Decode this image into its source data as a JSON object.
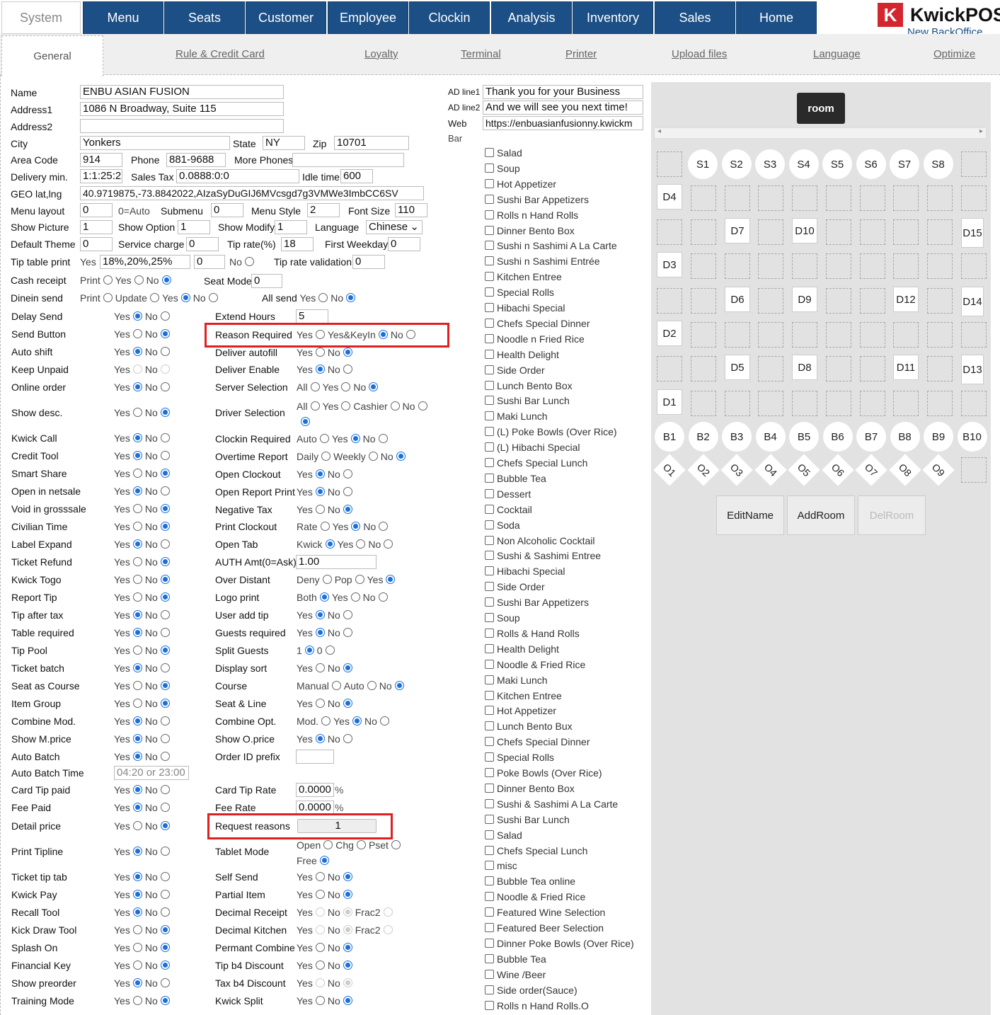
{
  "nav": {
    "system": "System",
    "items": [
      "Menu",
      "Seats",
      "Customer",
      "Employee",
      "Clockin",
      "Analysis",
      "Inventory",
      "Sales",
      "Home"
    ]
  },
  "logo": {
    "mark": "K",
    "name": "KwickPOS",
    "sub": "New BackOffice"
  },
  "tabs": {
    "general": "General",
    "links": [
      "Rule & Credit Card",
      "Loyalty",
      "Terminal",
      "Printer",
      "Upload files",
      "Language",
      "Optimize"
    ]
  },
  "store": {
    "name_label": "Name",
    "name": "ENBU ASIAN FUSION",
    "addr1_label": "Address1",
    "addr1": "1086 N Broadway,  Suite 115",
    "addr2_label": "Address2",
    "addr2": "",
    "city_label": "City",
    "city": "Yonkers",
    "state_label": "State",
    "state": "NY",
    "zip_label": "Zip",
    "zip": "10701",
    "area_label": "Area Code",
    "area": "914",
    "phone_label": "Phone",
    "phone": "881-9688",
    "more_label": "More Phones",
    "more": "",
    "delivery_label": "Delivery min.",
    "delivery": "1:1:25:2",
    "tax_label": "Sales Tax",
    "tax": "0.0888:0:0",
    "idle_label": "Idle time",
    "idle": "600",
    "geo_label": "GEO lat,lng",
    "geo": "40.9719875,-73.8842022,AIzaSyDuGIJ6MVcsgd7g3VMWe3ImbCC6SV",
    "menulayout_label": "Menu layout",
    "menulayout": "0",
    "auto_label": "0=Auto",
    "submenu_label": "Submenu",
    "submenu": "0",
    "menustyle_label": "Menu Style",
    "menustyle": "2",
    "fontsize_label": "Font Size",
    "fontsize": "110",
    "showpic_label": "Show Picture",
    "showpic": "1",
    "showopt_label": "Show Option",
    "showopt": "1",
    "showmod_label": "Show Modify",
    "showmod": "1",
    "lang_label": "Language",
    "lang": "Chinese",
    "theme_label": "Default Theme",
    "theme": "0",
    "svc_label": "Service charge",
    "svc": "0",
    "tiprate_label": "Tip rate(%)",
    "tiprate": "18",
    "firstwk_label": "First Weekday",
    "firstwk": "0",
    "tiptable_label": "Tip table print",
    "tiptable_yes": "Yes",
    "tiptable": "18%,20%,25%",
    "tiptable2": "0",
    "no": "No",
    "tipval_label": "Tip rate validation",
    "tipval": "0",
    "cash_label": "Cash receipt",
    "print": "Print",
    "yes": "Yes",
    "seatmode_label": "Seat Mode",
    "seatmode": "0",
    "dinein_label": "Dinein send",
    "update": "Update",
    "allsend_label": "All send"
  },
  "left_rows": [
    {
      "label": "Delay Send",
      "a": "Yes",
      "b": "No",
      "sel": "a"
    },
    {
      "label": "Send Button",
      "a": "Yes",
      "b": "No",
      "sel": "b"
    },
    {
      "label": "Auto shift",
      "a": "Yes",
      "b": "No",
      "sel": "a"
    },
    {
      "label": "Keep Unpaid",
      "a": "Yes",
      "b": "No",
      "sel": "dis"
    },
    {
      "label": "Online order",
      "a": "Yes",
      "b": "No",
      "sel": "a"
    },
    {
      "label": "Show desc.",
      "a": "Yes",
      "b": "No",
      "sel": "b"
    },
    {
      "label": "Kwick Call",
      "a": "Yes",
      "b": "No",
      "sel": "a"
    },
    {
      "label": "Credit Tool",
      "a": "Yes",
      "b": "No",
      "sel": "a"
    },
    {
      "label": "Smart Share",
      "a": "Yes",
      "b": "No",
      "sel": "b"
    },
    {
      "label": "Open in netsale",
      "a": "Yes",
      "b": "No",
      "sel": "a"
    },
    {
      "label": "Void in grosssale",
      "a": "Yes",
      "b": "No",
      "sel": "b"
    },
    {
      "label": "Civilian Time",
      "a": "Yes",
      "b": "No",
      "sel": "b"
    },
    {
      "label": "Label Expand",
      "a": "Yes",
      "b": "No",
      "sel": "a"
    },
    {
      "label": "Ticket Refund",
      "a": "Yes",
      "b": "No",
      "sel": "b"
    },
    {
      "label": "Kwick Togo",
      "a": "Yes",
      "b": "No",
      "sel": "b"
    },
    {
      "label": "Report Tip",
      "a": "Yes",
      "b": "No",
      "sel": "b"
    },
    {
      "label": "Tip after tax",
      "a": "Yes",
      "b": "No",
      "sel": "a"
    },
    {
      "label": "Table required",
      "a": "Yes",
      "b": "No",
      "sel": "a"
    },
    {
      "label": "Tip Pool",
      "a": "Yes",
      "b": "No",
      "sel": "b"
    },
    {
      "label": "Ticket batch",
      "a": "Yes",
      "b": "No",
      "sel": "a"
    },
    {
      "label": "Seat as Course",
      "a": "Yes",
      "b": "No",
      "sel": "b"
    },
    {
      "label": "Item Group",
      "a": "Yes",
      "b": "No",
      "sel": "b"
    },
    {
      "label": "Combine Mod.",
      "a": "Yes",
      "b": "No",
      "sel": "a"
    },
    {
      "label": "Show M.price",
      "a": "Yes",
      "b": "No",
      "sel": "a"
    },
    {
      "label": "Auto Batch",
      "a": "Yes",
      "b": "No",
      "sel": "a"
    },
    {
      "label": "Auto Batch Time",
      "input": "04:20 or 23:00"
    },
    {
      "label": "Card Tip paid",
      "a": "Yes",
      "b": "No",
      "sel": "a"
    },
    {
      "label": "Fee Paid",
      "a": "Yes",
      "b": "No",
      "sel": "a"
    },
    {
      "label": "Detail price",
      "a": "Yes",
      "b": "No",
      "sel": "b"
    },
    {
      "label": "Print Tipline",
      "a": "Yes",
      "b": "No",
      "sel": "a"
    },
    {
      "label": "Ticket tip tab",
      "a": "Yes",
      "b": "No",
      "sel": "a"
    },
    {
      "label": "Kwick Pay",
      "a": "Yes",
      "b": "No",
      "sel": "a"
    },
    {
      "label": "Recall Tool",
      "a": "Yes",
      "b": "No",
      "sel": "a"
    },
    {
      "label": "Kick Draw Tool",
      "a": "Yes",
      "b": "No",
      "sel": "b"
    },
    {
      "label": "Splash On",
      "a": "Yes",
      "b": "No",
      "sel": "b"
    },
    {
      "label": "Financial Key",
      "a": "Yes",
      "b": "No",
      "sel": "b"
    },
    {
      "label": "Show preorder",
      "a": "Yes",
      "b": "No",
      "sel": "a"
    },
    {
      "label": "Training Mode",
      "a": "Yes",
      "b": "No",
      "sel": "b"
    }
  ],
  "right_rows": [
    {
      "label": "Extend Hours",
      "input": "5"
    },
    {
      "label": "Reason Required",
      "opts": [
        "Yes",
        "Yes&KeyIn",
        "No"
      ],
      "sel": 1
    },
    {
      "label": "Deliver autofill",
      "opts": [
        "Yes",
        "No"
      ],
      "sel": 1
    },
    {
      "label": "Deliver Enable",
      "opts": [
        "Yes",
        "No"
      ],
      "sel": 0
    },
    {
      "label": "Server Selection",
      "opts": [
        "All",
        "Yes",
        "No"
      ],
      "sel": 2
    },
    {
      "label": "Driver Selection",
      "opts": [
        "All",
        "Yes",
        "Cashier",
        "No"
      ],
      "sel": 3
    },
    {
      "label": "Clockin Required",
      "opts": [
        "Auto",
        "Yes",
        "No"
      ],
      "sel": 1
    },
    {
      "label": "Overtime Report",
      "opts": [
        "Daily",
        "Weekly",
        "No"
      ],
      "sel": 2
    },
    {
      "label": "Open Clockout",
      "opts": [
        "Yes",
        "No"
      ],
      "sel": 0
    },
    {
      "label": "Open Report Print",
      "opts": [
        "Yes",
        "No"
      ],
      "sel": 0
    },
    {
      "label": "Negative Tax",
      "opts": [
        "Yes",
        "No"
      ],
      "sel": 1
    },
    {
      "label": "Print Clockout",
      "opts": [
        "Rate",
        "Yes",
        "No"
      ],
      "sel": 1
    },
    {
      "label": "Open Tab",
      "opts": [
        "Kwick",
        "Yes",
        "No"
      ],
      "sel": 0
    },
    {
      "label": "AUTH Amt(0=Ask)",
      "input": "1.00"
    },
    {
      "label": "Over Distant",
      "opts": [
        "Deny",
        "Pop",
        "Yes"
      ],
      "sel": 2
    },
    {
      "label": "Logo print",
      "opts": [
        "Both",
        "Yes",
        "No"
      ],
      "sel": 0
    },
    {
      "label": "User add tip",
      "opts": [
        "Yes",
        "No"
      ],
      "sel": 0
    },
    {
      "label": "Guests required",
      "opts": [
        "Yes",
        "No"
      ],
      "sel": 0
    },
    {
      "label": "Split Guests",
      "opts": [
        "1",
        "0"
      ],
      "sel": 0
    },
    {
      "label": "Display sort",
      "opts": [
        "Yes",
        "No"
      ],
      "sel": 1
    },
    {
      "label": "Course",
      "opts": [
        "Manual",
        "Auto",
        "No"
      ],
      "sel": 2
    },
    {
      "label": "Seat & Line",
      "opts": [
        "Yes",
        "No"
      ],
      "sel": 1
    },
    {
      "label": "Combine Opt.",
      "opts": [
        "Mod.",
        "Yes",
        "No"
      ],
      "sel": 1
    },
    {
      "label": "Show O.price",
      "opts": [
        "Yes",
        "No"
      ],
      "sel": 0
    },
    {
      "label": "Order ID prefix",
      "input": ""
    },
    {
      "label": "",
      "skip": true
    },
    {
      "label": "Card Tip Rate",
      "input": "0.0000",
      "suffix": "%"
    },
    {
      "label": "Fee Rate",
      "input": "0.0000",
      "suffix": "%"
    },
    {
      "label": "Request reasons",
      "button": "1"
    },
    {
      "label": "Tablet Mode",
      "opts": [
        "Open",
        "Chg",
        "Pset"
      ],
      "sel": -1,
      "extra": "Free"
    },
    {
      "label": "Self Send",
      "opts": [
        "Yes",
        "No"
      ],
      "sel": 1
    },
    {
      "label": "Partial Item",
      "opts": [
        "Yes",
        "No"
      ],
      "sel": 1
    },
    {
      "label": "Decimal Receipt",
      "opts": [
        "Yes",
        "No",
        "Frac2"
      ],
      "sel": -2
    },
    {
      "label": "Decimal Kitchen",
      "opts": [
        "Yes",
        "No",
        "Frac2"
      ],
      "sel": -2
    },
    {
      "label": "Permant Combine",
      "opts": [
        "Yes",
        "No"
      ],
      "sel": 1
    },
    {
      "label": "Tip b4 Discount",
      "opts": [
        "Yes",
        "No"
      ],
      "sel": 1
    },
    {
      "label": "Tax b4 Discount",
      "opts": [
        "Yes",
        "No"
      ],
      "sel": -3
    },
    {
      "label": "Kwick Split",
      "opts": [
        "Yes",
        "No"
      ],
      "sel": 1
    }
  ],
  "ad": {
    "l1_label": "AD line1",
    "l1": "Thank you for your Business",
    "l2_label": "AD line2",
    "l2": "And we will see you next time!",
    "web_label": "Web",
    "web": "https://enbuasianfusionny.kwickm",
    "bar_label": "Bar"
  },
  "categories": [
    "Salad",
    "Soup",
    "Hot Appetizer",
    "Sushi Bar Appetizers",
    "Rolls n Hand Rolls",
    "Dinner Bento Box",
    "Sushi n Sashimi A La Carte",
    "Sushi n Sashimi Entrée",
    "Kitchen Entree",
    "Special Rolls",
    "Hibachi Special",
    "Chefs Special Dinner",
    "Noodle n Fried Rice",
    "Health Delight",
    "Side Order",
    "Lunch Bento Box",
    "Sushi Bar Lunch",
    "Maki Lunch",
    "(L) Poke Bowls (Over Rice)",
    "(L) Hibachi Special",
    "Chefs Special Lunch",
    "Bubble Tea",
    "Dessert",
    "Cocktail",
    "Soda",
    "Non Alcoholic Cocktail",
    "Sushi & Sashimi Entree",
    "Hibachi Special",
    "Side Order",
    "Sushi Bar Appetizers",
    "Soup",
    "Rolls & Hand Rolls",
    "Health Delight",
    "Noodle & Fried Rice",
    "Maki Lunch",
    "Kitchen Entree",
    "Hot Appetizer",
    "Lunch Bento Bux",
    "Chefs Special Dinner",
    "Special Rolls",
    "Poke Bowls (Over Rice)",
    "Dinner Bento Box",
    "Sushi & Sashimi A La Carte",
    "Sushi Bar Lunch",
    "Salad",
    "Chefs Special Lunch",
    "misc",
    "Bubble Tea online",
    "Noodle & Fried Rice",
    "Featured Wine Selection",
    "Featured Beer Selection",
    "Dinner Poke Bowls (Over Rice)",
    "Bubble Tea",
    "Wine /Beer",
    "Side order(Sauce)",
    "Rolls n Hand Rolls.O"
  ],
  "room": {
    "title": "room",
    "seats": [
      "S1",
      "S2",
      "S3",
      "S4",
      "S5",
      "S6",
      "S7",
      "S8"
    ],
    "tables": [
      {
        "t": "D4",
        "r": 1,
        "c": 0
      },
      {
        "t": "D7",
        "r": 2,
        "c": 2
      },
      {
        "t": "D10",
        "r": 2,
        "c": 4
      },
      {
        "t": "D15",
        "r": 2,
        "c": 9
      },
      {
        "t": "D3",
        "r": 3,
        "c": 0
      },
      {
        "t": "D6",
        "r": 4,
        "c": 2
      },
      {
        "t": "D9",
        "r": 4,
        "c": 4
      },
      {
        "t": "D12",
        "r": 4,
        "c": 7
      },
      {
        "t": "D14",
        "r": 4,
        "c": 9
      },
      {
        "t": "D2",
        "r": 5,
        "c": 0
      },
      {
        "t": "D5",
        "r": 6,
        "c": 2
      },
      {
        "t": "D8",
        "r": 6,
        "c": 4
      },
      {
        "t": "D11",
        "r": 6,
        "c": 7
      },
      {
        "t": "D13",
        "r": 6,
        "c": 9
      },
      {
        "t": "D1",
        "r": 7,
        "c": 0
      }
    ],
    "bars": [
      "B1",
      "B2",
      "B3",
      "B4",
      "B5",
      "B6",
      "B7",
      "B8",
      "B9",
      "B10"
    ],
    "others": [
      "O1",
      "O2",
      "O3",
      "O4",
      "O5",
      "O6",
      "O7",
      "O8",
      "O9"
    ],
    "buttons": [
      "EditName",
      "AddRoom",
      "DelRoom"
    ]
  }
}
